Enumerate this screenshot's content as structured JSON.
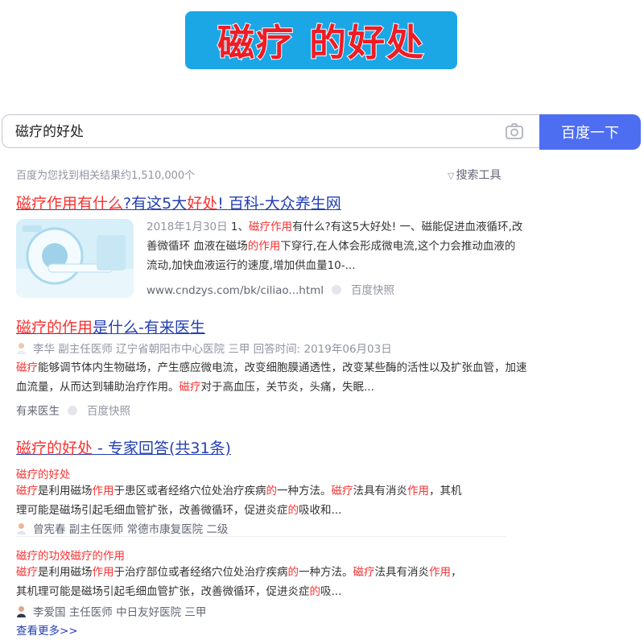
{
  "banner": {
    "text": "磁疗 的好处"
  },
  "search": {
    "query": "磁疗的好处",
    "button": "百度一下"
  },
  "stats": "百度为您找到相关结果约1,510,000个",
  "tools": "搜索工具",
  "results": [
    {
      "title": [
        "磁疗作用有什么",
        "?有这5大",
        "好处",
        "! 百科-大众养生网"
      ],
      "abstract": {
        "date": "2018年1月30日",
        "parts": [
          "1、",
          "磁疗作用",
          "有什么?有这5大好处! 一、磁能促进血液循环,改善微循环 血液在磁场",
          "的作用",
          "下穿行,在人体会形成微电流,这个力会推动血液的流动,加快血液运行的速度,增加供血量10-..."
        ]
      },
      "url": "www.cndzys.com/bk/ciliao...html",
      "snapshot": "百度快照"
    },
    {
      "title": [
        "磁疗的作用",
        "是什么-有来医生"
      ],
      "meta": "李华  副主任医师  辽宁省朝阳市中心医院  三甲  回答时间: 2019年06月03日",
      "abstract": [
        "磁疗",
        "能够调节体内生物磁场，产生感应微电流，改变细胞膜通透性，改变某些酶的活性以及扩张血管，加速血流量，从而达到辅助治疗作用。",
        "磁疗",
        "对于高血压，关节炎，头痛，失眠..."
      ],
      "source": "有来医生",
      "snapshot": "百度快照"
    },
    {
      "title": [
        "磁疗的好处",
        " - 专家回答(共31条)"
      ],
      "answers": [
        {
          "subhead": "磁疗的好处",
          "line1": [
            "磁疗",
            "是利用磁场",
            "作用",
            "于患区或者经络穴位处治疗疾病",
            "的",
            "一种方法。",
            "磁疗",
            "法具有消炎",
            "作用",
            "，其机"
          ],
          "line2": [
            "理可能是磁场引起毛细血管扩张，改善微循环，促进炎症",
            "的",
            "吸收和..."
          ],
          "doctor": "曾宪春  副主任医师  常德市康复医院  二级"
        },
        {
          "subhead": "磁疗的功效磁疗的作用",
          "line1": [
            "磁疗",
            "是利用磁场",
            "作用",
            "于治疗部位或者经络穴位处治疗疾病",
            "的",
            "一种方法。",
            "磁疗",
            "法具有消炎",
            "作用",
            "，"
          ],
          "line2": [
            "其机理可能是磁场引起毛细血管扩张，改善微循环，促进炎症",
            "的",
            "吸..."
          ],
          "doctor": "李爱国  主任医师  中日友好医院  三甲"
        }
      ],
      "more": "查看更多>>"
    }
  ]
}
